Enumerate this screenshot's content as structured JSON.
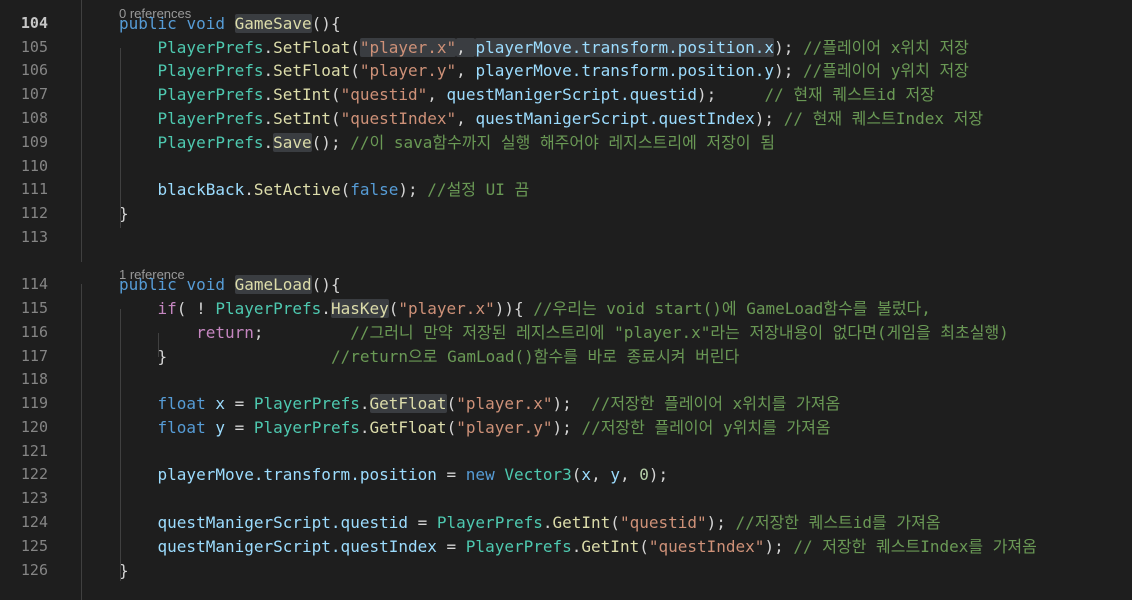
{
  "codelens": {
    "gamesave_refs": "0 references",
    "gameload_refs": "1 reference"
  },
  "lines": [
    {
      "n": "104",
      "active": true,
      "tokens": [
        [
          "kw",
          "public"
        ],
        [
          "p",
          " "
        ],
        [
          "kw",
          "void"
        ],
        [
          "p",
          " "
        ],
        [
          "fnhl",
          "GameSave"
        ],
        [
          "p",
          "(){"
        ]
      ]
    },
    {
      "n": "105",
      "active": false,
      "tokens": [
        [
          "p",
          "    "
        ],
        [
          "ty",
          "PlayerPrefs"
        ],
        [
          "p",
          "."
        ],
        [
          "fn",
          "SetFloat"
        ],
        [
          "p",
          "("
        ],
        [
          "strhl",
          "\"player.x\""
        ],
        [
          "phl",
          ", "
        ],
        [
          "varhl",
          "playerMove.transform.position.x"
        ],
        [
          "p",
          ");"
        ],
        [
          "p",
          " "
        ],
        [
          "cm",
          "//플레이어 x위치 저장"
        ]
      ]
    },
    {
      "n": "106",
      "active": false,
      "tokens": [
        [
          "p",
          "    "
        ],
        [
          "ty",
          "PlayerPrefs"
        ],
        [
          "p",
          "."
        ],
        [
          "fn",
          "SetFloat"
        ],
        [
          "p",
          "("
        ],
        [
          "str",
          "\"player.y\""
        ],
        [
          "p",
          ", "
        ],
        [
          "var",
          "playerMove.transform.position.y"
        ],
        [
          "p",
          ");"
        ],
        [
          "p",
          " "
        ],
        [
          "cm",
          "//플레이어 y위치 저장"
        ]
      ]
    },
    {
      "n": "107",
      "active": false,
      "tokens": [
        [
          "p",
          "    "
        ],
        [
          "ty",
          "PlayerPrefs"
        ],
        [
          "p",
          "."
        ],
        [
          "fn",
          "SetInt"
        ],
        [
          "p",
          "("
        ],
        [
          "str",
          "\"questid\""
        ],
        [
          "p",
          ", "
        ],
        [
          "var",
          "questManigerScript.questid"
        ],
        [
          "p",
          ");"
        ],
        [
          "p",
          "     "
        ],
        [
          "cm",
          "// 현재 퀘스트id 저장"
        ]
      ]
    },
    {
      "n": "108",
      "active": false,
      "tokens": [
        [
          "p",
          "    "
        ],
        [
          "ty",
          "PlayerPrefs"
        ],
        [
          "p",
          "."
        ],
        [
          "fn",
          "SetInt"
        ],
        [
          "p",
          "("
        ],
        [
          "str",
          "\"questIndex\""
        ],
        [
          "p",
          ", "
        ],
        [
          "var",
          "questManigerScript.questIndex"
        ],
        [
          "p",
          ");"
        ],
        [
          "p",
          " "
        ],
        [
          "cm",
          "// 현재 퀘스트Index 저장"
        ]
      ]
    },
    {
      "n": "109",
      "active": false,
      "tokens": [
        [
          "p",
          "    "
        ],
        [
          "ty",
          "PlayerPrefs"
        ],
        [
          "p",
          "."
        ],
        [
          "fnhl",
          "Save"
        ],
        [
          "p",
          "();"
        ],
        [
          "p",
          " "
        ],
        [
          "cm",
          "//이 sava함수까지 실행 해주어야 레지스트리에 저장이 됨"
        ]
      ]
    },
    {
      "n": "110",
      "active": false,
      "tokens": []
    },
    {
      "n": "111",
      "active": false,
      "tokens": [
        [
          "p",
          "    "
        ],
        [
          "var",
          "blackBack"
        ],
        [
          "p",
          "."
        ],
        [
          "fn",
          "SetActive"
        ],
        [
          "p",
          "("
        ],
        [
          "kw",
          "false"
        ],
        [
          "p",
          ");"
        ],
        [
          "p",
          " "
        ],
        [
          "cm",
          "//설정 UI 끔"
        ]
      ]
    },
    {
      "n": "112",
      "active": false,
      "tokens": [
        [
          "p",
          "}"
        ]
      ]
    },
    {
      "n": "113",
      "active": false,
      "tokens": []
    },
    {
      "n": "114",
      "active": false,
      "tokens": [
        [
          "kw",
          "public"
        ],
        [
          "p",
          " "
        ],
        [
          "kw",
          "void"
        ],
        [
          "p",
          " "
        ],
        [
          "fnhl",
          "GameLoad"
        ],
        [
          "p",
          "(){"
        ]
      ]
    },
    {
      "n": "115",
      "active": false,
      "tokens": [
        [
          "p",
          "    "
        ],
        [
          "ctl",
          "if"
        ],
        [
          "p",
          "( ! "
        ],
        [
          "ty",
          "PlayerPrefs"
        ],
        [
          "p",
          "."
        ],
        [
          "fnhl",
          "HasKey"
        ],
        [
          "p",
          "("
        ],
        [
          "str",
          "\"player.x\""
        ],
        [
          "p",
          "))"
        ],
        [
          "p",
          "{ "
        ],
        [
          "cm",
          "//우리는 void start()에 GameLoad함수를 불렀다,"
        ]
      ]
    },
    {
      "n": "116",
      "active": false,
      "tokens": [
        [
          "p",
          "        "
        ],
        [
          "ctl",
          "return"
        ],
        [
          "p",
          ";"
        ],
        [
          "p",
          "         "
        ],
        [
          "cm",
          "//그러니 만약 저장된 레지스트리에 \"player.x\"라는 저장내용이 없다면(게임을 최초실행)"
        ]
      ]
    },
    {
      "n": "117",
      "active": false,
      "tokens": [
        [
          "p",
          "    }"
        ],
        [
          "p",
          "                 "
        ],
        [
          "cm",
          "//return으로 GamLoad()함수를 바로 종료시켜 버린다"
        ]
      ]
    },
    {
      "n": "118",
      "active": false,
      "tokens": []
    },
    {
      "n": "119",
      "active": false,
      "tokens": [
        [
          "p",
          "    "
        ],
        [
          "kw",
          "float"
        ],
        [
          "p",
          " "
        ],
        [
          "var",
          "x"
        ],
        [
          "p",
          " = "
        ],
        [
          "ty",
          "PlayerPrefs"
        ],
        [
          "p",
          "."
        ],
        [
          "fnhl",
          "GetFloat"
        ],
        [
          "p",
          "("
        ],
        [
          "str",
          "\"player.x\""
        ],
        [
          "p",
          ");"
        ],
        [
          "p",
          "  "
        ],
        [
          "cm",
          "//저장한 플레이어 x위치를 가져옴"
        ]
      ]
    },
    {
      "n": "120",
      "active": false,
      "tokens": [
        [
          "p",
          "    "
        ],
        [
          "kw",
          "float"
        ],
        [
          "p",
          " "
        ],
        [
          "var",
          "y"
        ],
        [
          "p",
          " = "
        ],
        [
          "ty",
          "PlayerPrefs"
        ],
        [
          "p",
          "."
        ],
        [
          "fn",
          "GetFloat"
        ],
        [
          "p",
          "("
        ],
        [
          "str",
          "\"player.y\""
        ],
        [
          "p",
          ");"
        ],
        [
          "p",
          " "
        ],
        [
          "cm",
          "//저장한 플레이어 y위치를 가져옴"
        ]
      ]
    },
    {
      "n": "121",
      "active": false,
      "tokens": []
    },
    {
      "n": "122",
      "active": false,
      "tokens": [
        [
          "p",
          "    "
        ],
        [
          "var",
          "playerMove.transform.position"
        ],
        [
          "p",
          " = "
        ],
        [
          "kw",
          "new"
        ],
        [
          "p",
          " "
        ],
        [
          "ty",
          "Vector3"
        ],
        [
          "p",
          "("
        ],
        [
          "var",
          "x"
        ],
        [
          "p",
          ", "
        ],
        [
          "var",
          "y"
        ],
        [
          "p",
          ", "
        ],
        [
          "num",
          "0"
        ],
        [
          "p",
          ");"
        ]
      ]
    },
    {
      "n": "123",
      "active": false,
      "tokens": []
    },
    {
      "n": "124",
      "active": false,
      "tokens": [
        [
          "p",
          "    "
        ],
        [
          "var",
          "questManigerScript.questid"
        ],
        [
          "p",
          " = "
        ],
        [
          "ty",
          "PlayerPrefs"
        ],
        [
          "p",
          "."
        ],
        [
          "fn",
          "GetInt"
        ],
        [
          "p",
          "("
        ],
        [
          "str",
          "\"questid\""
        ],
        [
          "p",
          ");"
        ],
        [
          "p",
          " "
        ],
        [
          "cm",
          "//저장한 퀘스트id를 가져옴"
        ]
      ]
    },
    {
      "n": "125",
      "active": false,
      "tokens": [
        [
          "p",
          "    "
        ],
        [
          "var",
          "questManigerScript.questIndex"
        ],
        [
          "p",
          " = "
        ],
        [
          "ty",
          "PlayerPrefs"
        ],
        [
          "p",
          "."
        ],
        [
          "fn",
          "GetInt"
        ],
        [
          "p",
          "("
        ],
        [
          "str",
          "\"questIndex\""
        ],
        [
          "p",
          ");"
        ],
        [
          "p",
          " "
        ],
        [
          "cm",
          "// 저장한 퀘스트Index를 가져옴"
        ]
      ]
    },
    {
      "n": "126",
      "active": false,
      "tokens": [
        [
          "p",
          "}"
        ]
      ]
    }
  ]
}
